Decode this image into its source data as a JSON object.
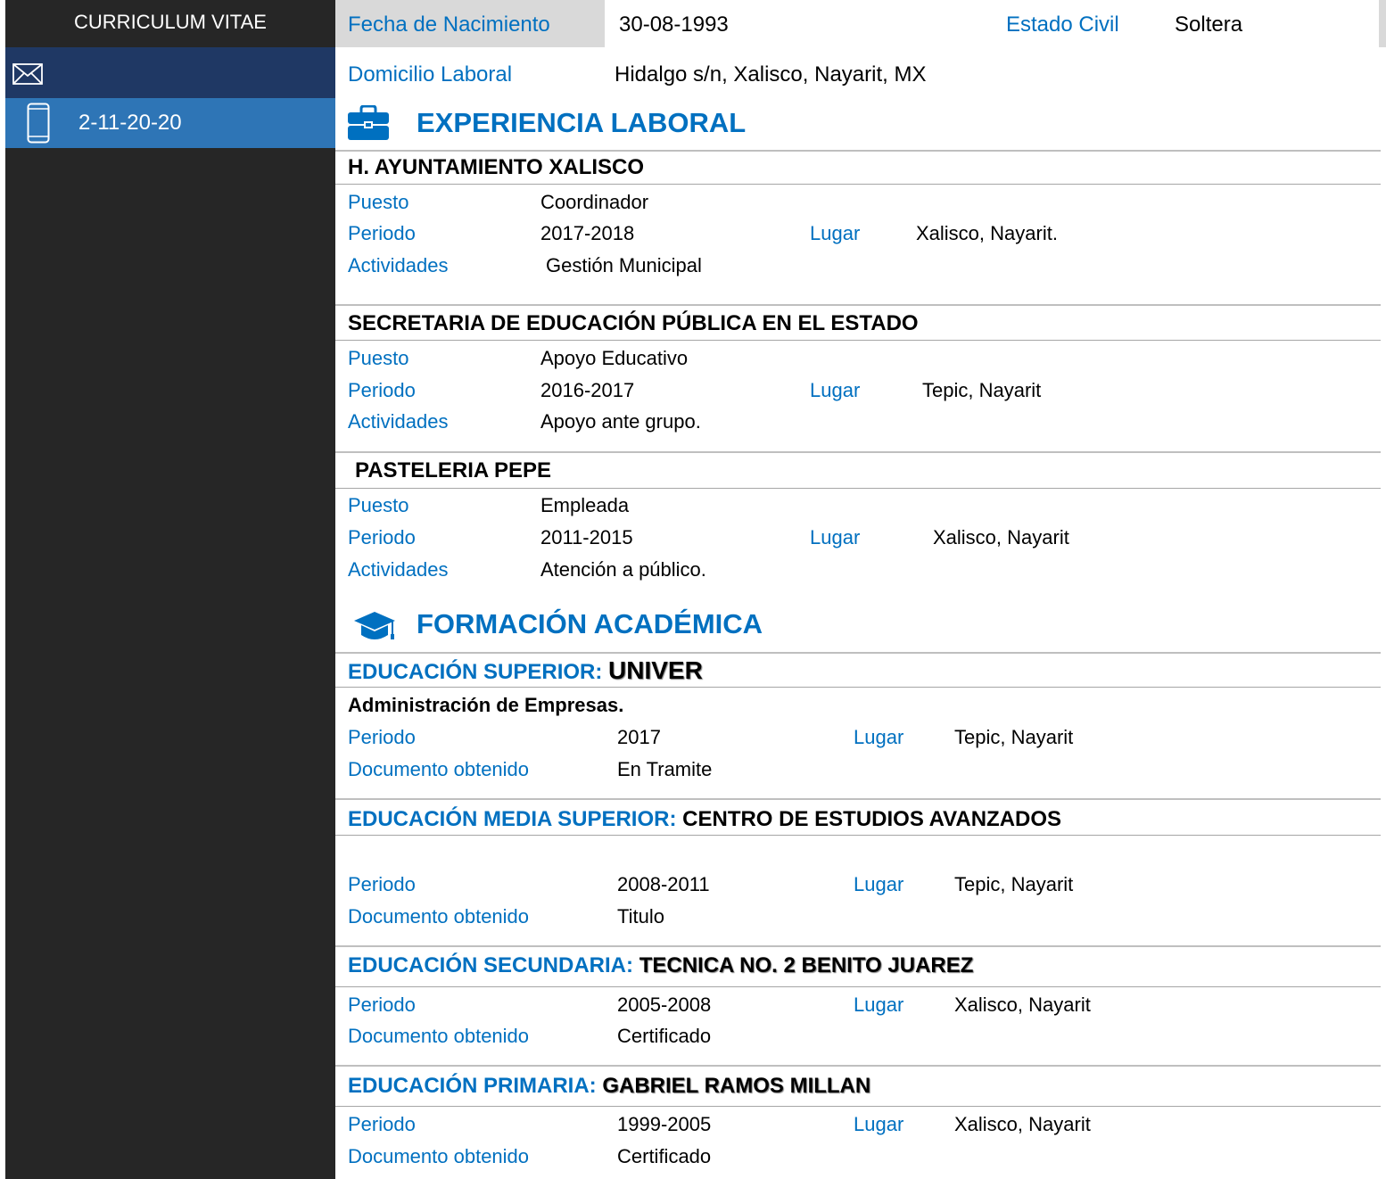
{
  "sidebar": {
    "title": "CURRICULUM VITAE",
    "email_icon": "envelope-icon",
    "email_value": "",
    "phone_icon": "mobile-phone-icon",
    "phone_value": "2-11-20-20"
  },
  "personal": {
    "birth_label": "Fecha de Nacimiento",
    "birth_value": "30-08-1993",
    "civil_label": "Estado Civil",
    "civil_value": "Soltera",
    "address_label": "Domicilio Laboral",
    "address_value": "Hidalgo s/n, Xalisco, Nayarit, MX"
  },
  "experience": {
    "icon": "briefcase-icon",
    "title": "EXPERIENCIA LABORAL",
    "jobs": [
      {
        "company": "H. AYUNTAMIENTO XALISCO",
        "puesto_label": "Puesto",
        "puesto": "Coordinador",
        "periodo_label": "Periodo",
        "periodo": "2017-2018",
        "lugar_label": "Lugar",
        "lugar": "Xalisco, Nayarit.",
        "actividades_label": "Actividades",
        "actividades": "Gestión Municipal"
      },
      {
        "company": "SECRETARIA DE EDUCACIÓN PÚBLICA EN EL ESTADO",
        "puesto_label": "Puesto",
        "puesto": "Apoyo Educativo",
        "periodo_label": "Periodo",
        "periodo": "2016-2017",
        "lugar_label": "Lugar",
        "lugar": "Tepic, Nayarit",
        "actividades_label": "Actividades",
        "actividades": "Apoyo ante grupo."
      },
      {
        "company": "PASTELERIA PEPE",
        "puesto_label": "Puesto",
        "puesto": "Empleada",
        "periodo_label": "Periodo",
        "periodo": "2011-2015",
        "lugar_label": "Lugar",
        "lugar": "Xalisco, Nayarit",
        "actividades_label": "Actividades",
        "actividades": "Atención a público."
      }
    ]
  },
  "education": {
    "icon": "graduation-cap-icon",
    "title": "FORMACIÓN ACADÉMICA",
    "levels": [
      {
        "level": "EDUCACIÓN SUPERIOR:",
        "school": "UNIVER",
        "career": "Administración de Empresas.",
        "periodo_label": "Periodo",
        "periodo": "2017",
        "lugar_label": "Lugar",
        "lugar": "Tepic, Nayarit",
        "documento_label": "Documento obtenido",
        "documento": "En Tramite"
      },
      {
        "level": "EDUCACIÓN MEDIA SUPERIOR:",
        "school": "CENTRO DE ESTUDIOS AVANZADOS",
        "periodo_label": "Periodo",
        "periodo": "2008-2011",
        "lugar_label": "Lugar",
        "lugar": "Tepic, Nayarit",
        "documento_label": "Documento obtenido",
        "documento": "Titulo"
      },
      {
        "level": "EDUCACIÓN SECUNDARIA:",
        "school": "TECNICA NO. 2 BENITO JUAREZ",
        "periodo_label": "Periodo",
        "periodo": "2005-2008",
        "lugar_label": "Lugar",
        "lugar": "Xalisco, Nayarit",
        "documento_label": "Documento obtenido",
        "documento": "Certificado"
      },
      {
        "level": "EDUCACIÓN PRIMARIA:",
        "school": "GABRIEL RAMOS MILLAN",
        "periodo_label": "Periodo",
        "periodo": "1999-2005",
        "lugar_label": "Lugar",
        "lugar": "Xalisco, Nayarit",
        "documento_label": "Documento obtenido",
        "documento": "Certificado"
      }
    ]
  }
}
